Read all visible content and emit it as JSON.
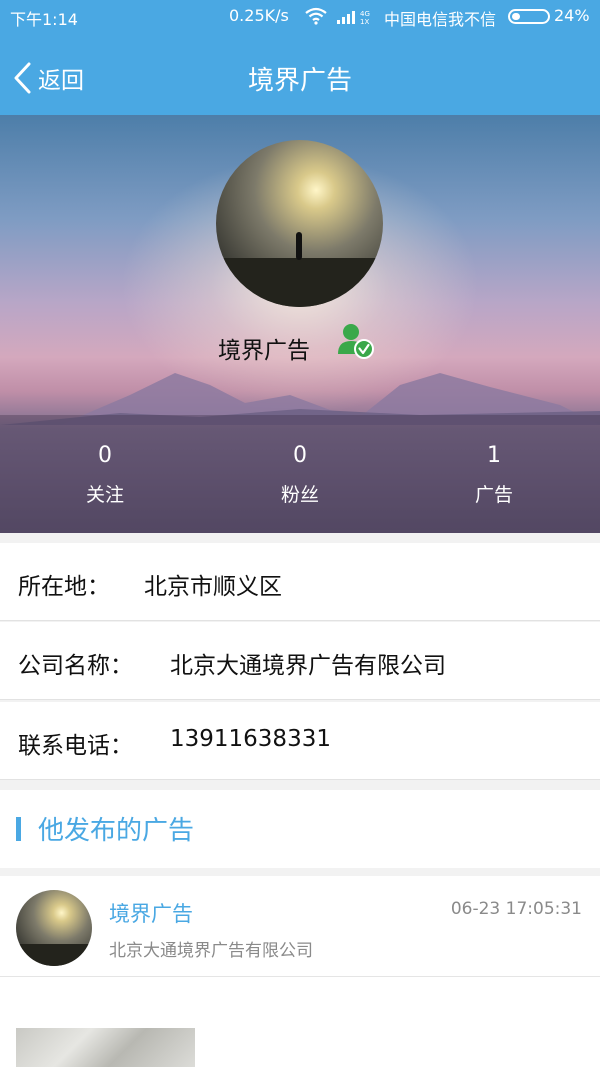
{
  "status_bar": {
    "time": "下午1:14",
    "speed": "0.25K/s",
    "carrier": "中国电信我不信",
    "battery_pct": "24%",
    "battery_level": 0.24
  },
  "nav": {
    "back_label": "返回",
    "title": "境界广告"
  },
  "profile": {
    "name": "境界广告",
    "verified": true,
    "stats": [
      {
        "value": "0",
        "label": "关注"
      },
      {
        "value": "0",
        "label": "粉丝"
      },
      {
        "value": "1",
        "label": "广告"
      }
    ]
  },
  "info": [
    {
      "label": "所在地：",
      "value": "北京市顺义区"
    },
    {
      "label": "公司名称：",
      "value": "北京大通境界广告有限公司"
    },
    {
      "label": "联系电话：",
      "value": "13911638331"
    }
  ],
  "section": {
    "title": "他发布的广告"
  },
  "ads": [
    {
      "title": "境界广告",
      "time": "06-23 17:05:31",
      "company": "北京大通境界广告有限公司"
    }
  ],
  "colors": {
    "accent": "#4aa8e3",
    "verified": "#3aa84a"
  }
}
